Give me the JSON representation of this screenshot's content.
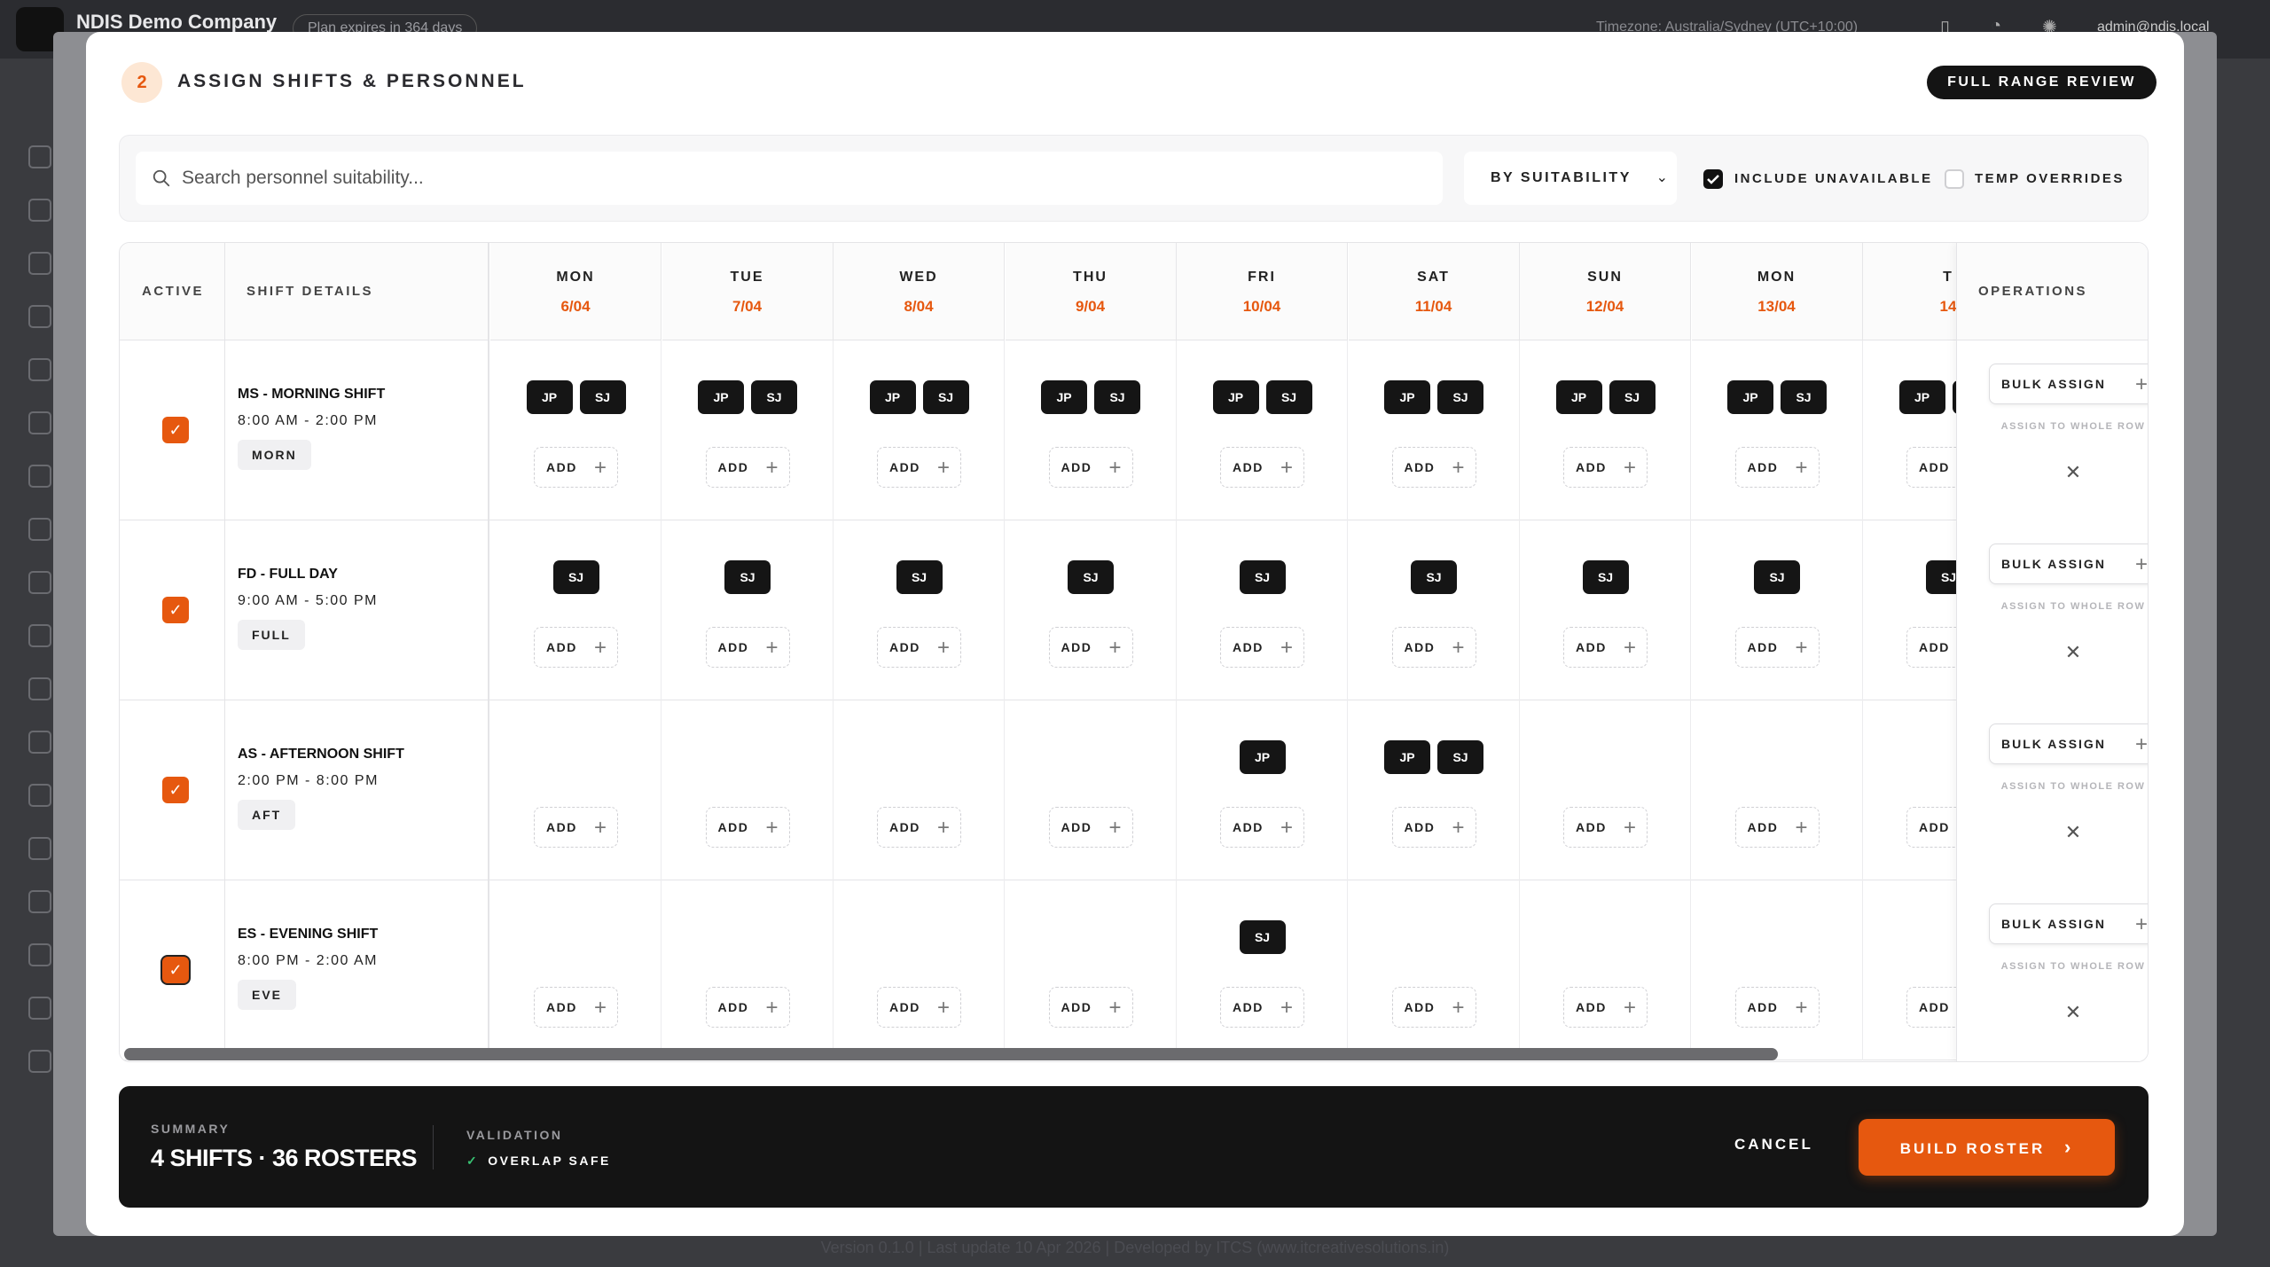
{
  "app": {
    "company": "NDIS Demo Company",
    "plan_badge": "Plan expires in 364 days",
    "timezone": "Timezone: Australia/Sydney (UTC+10:00)",
    "user": "admin@ndis.local"
  },
  "footer": {
    "text": "Version 0.1.0    |    Last update 10 Apr 2026    |    Developed by ITCS (www.itcreativesolutions.in)"
  },
  "modal": {
    "step_number": "2",
    "title": "ASSIGN SHIFTS & PERSONNEL",
    "review_button": "FULL RANGE REVIEW"
  },
  "filters": {
    "search_placeholder": "Search personnel suitability...",
    "sort_value": "BY SUITABILITY",
    "include_unavailable": {
      "label": "INCLUDE UNAVAILABLE",
      "checked": true
    },
    "temp_overrides": {
      "label": "TEMP OVERRIDES",
      "checked": false
    }
  },
  "grid": {
    "col_active": "ACTIVE",
    "col_details": "SHIFT DETAILS",
    "col_operations": "OPERATIONS",
    "add_label": "ADD",
    "bulk_label": "BULK ASSIGN",
    "bulk_hint": "ASSIGN TO WHOLE ROW",
    "days": [
      {
        "name": "MON",
        "date": "6/04"
      },
      {
        "name": "TUE",
        "date": "7/04"
      },
      {
        "name": "WED",
        "date": "8/04"
      },
      {
        "name": "THU",
        "date": "9/04"
      },
      {
        "name": "FRI",
        "date": "10/04"
      },
      {
        "name": "SAT",
        "date": "11/04"
      },
      {
        "name": "SUN",
        "date": "12/04"
      },
      {
        "name": "MON",
        "date": "13/04"
      },
      {
        "name": "T",
        "date": "14"
      }
    ],
    "rows": [
      {
        "name": "MS - MORNING SHIFT",
        "time": "8:00 AM - 2:00 PM",
        "code": "MORN",
        "active": true,
        "cells": [
          [
            "JP",
            "SJ"
          ],
          [
            "JP",
            "SJ"
          ],
          [
            "JP",
            "SJ"
          ],
          [
            "JP",
            "SJ"
          ],
          [
            "JP",
            "SJ"
          ],
          [
            "JP",
            "SJ"
          ],
          [
            "JP",
            "SJ"
          ],
          [
            "JP",
            "SJ"
          ],
          [
            "JP",
            "SJ"
          ]
        ]
      },
      {
        "name": "FD - FULL DAY",
        "time": "9:00 AM - 5:00 PM",
        "code": "FULL",
        "active": true,
        "cells": [
          [
            "SJ"
          ],
          [
            "SJ"
          ],
          [
            "SJ"
          ],
          [
            "SJ"
          ],
          [
            "SJ"
          ],
          [
            "SJ"
          ],
          [
            "SJ"
          ],
          [
            "SJ"
          ],
          [
            "SJ"
          ]
        ]
      },
      {
        "name": "AS - AFTERNOON SHIFT",
        "time": "2:00 PM - 8:00 PM",
        "code": "AFT",
        "active": true,
        "cells": [
          [],
          [],
          [],
          [],
          [
            "JP"
          ],
          [
            "JP",
            "SJ"
          ],
          [],
          [],
          []
        ]
      },
      {
        "name": "ES - EVENING SHIFT",
        "time": "8:00 PM - 2:00 AM",
        "code": "EVE",
        "active": true,
        "cells": [
          [],
          [],
          [],
          [],
          [
            "SJ"
          ],
          [],
          [],
          [],
          []
        ]
      }
    ]
  },
  "summary": {
    "label": "SUMMARY",
    "value": "4 SHIFTS · 36 ROSTERS",
    "validation_label": "VALIDATION",
    "validation_value": "OVERLAP SAFE",
    "cancel": "CANCEL",
    "build": "BUILD ROSTER",
    "build_chevron": "›"
  },
  "icons": {
    "search": "search-icon",
    "check": "✓",
    "close": "✕",
    "plus": "+",
    "chevron": "⌄"
  },
  "colors": {
    "accent": "#e6580f",
    "dark": "#141414"
  }
}
